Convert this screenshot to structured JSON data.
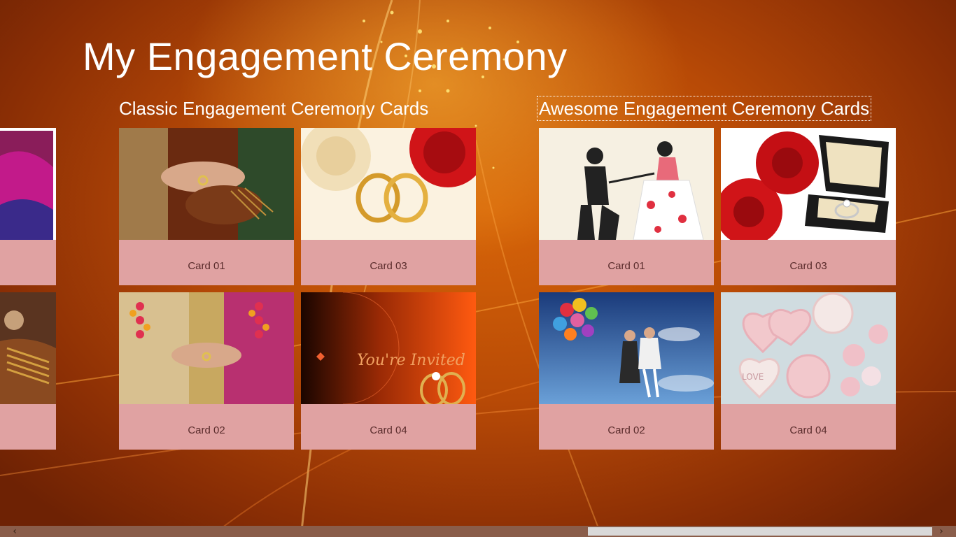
{
  "app": {
    "title": "My Engagement Ceremony"
  },
  "groups": [
    {
      "title": "Classic Engagement Ceremony Cards",
      "cards": [
        {
          "label": "Card 01",
          "image": "ring-exchange-hands-photo"
        },
        {
          "label": "Card 02",
          "image": "garland-ring-ceremony-photo"
        },
        {
          "label": "Card 03",
          "image": "gold-rings-roses-photo"
        },
        {
          "label": "Card 04",
          "image": "youre-invited-card-photo",
          "overlay_text": "You're Invited"
        }
      ]
    },
    {
      "title": "Awesome Engagement Ceremony Cards",
      "cards": [
        {
          "label": "Card 01",
          "image": "proposal-silhouette-illustration"
        },
        {
          "label": "Card 02",
          "image": "balloons-couple-sky-photo"
        },
        {
          "label": "Card 03",
          "image": "ring-box-roses-photo"
        },
        {
          "label": "Card 04",
          "image": "heart-cookies-photo"
        }
      ]
    }
  ],
  "colors": {
    "background_accent": "#c8560a",
    "tile_label_bg": "#e0a2a2",
    "tile_label_text": "#5a2c2c"
  },
  "scrollbar": {
    "left_arrow": "‹",
    "right_arrow": "›"
  }
}
